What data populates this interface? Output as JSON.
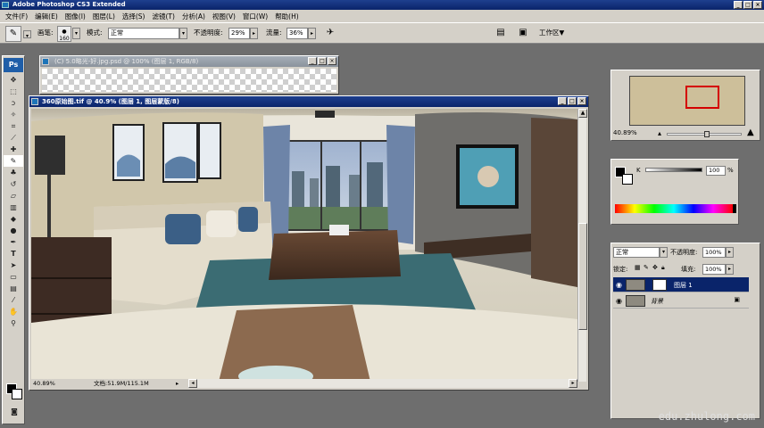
{
  "app": {
    "title": "Adobe Photoshop CS3 Extended",
    "window_buttons": [
      "_",
      "□",
      "×"
    ]
  },
  "menu": [
    "文件(F)",
    "编辑(E)",
    "图像(I)",
    "图层(L)",
    "选择(S)",
    "滤镜(T)",
    "分析(A)",
    "视图(V)",
    "窗口(W)",
    "帮助(H)"
  ],
  "options": {
    "brush_label": "画笔:",
    "brush_size": "160",
    "mode_label": "模式:",
    "mode_value": "正常",
    "opacity_label": "不透明度:",
    "opacity_value": "29%",
    "flow_label": "流量:",
    "flow_value": "36%",
    "workspace_label": "工作区▼"
  },
  "doc_back": {
    "title": "(C) 5.0略光-好.jpg.psd @ 100% (图层 1, RGB/8)"
  },
  "doc_main": {
    "title": "360原始图.tif @ 40.9% (图层 1, 图层蒙版/8)",
    "zoom": "40.89%",
    "file_info": "文档:51.9M/115.1M"
  },
  "navigator": {
    "zoom": "40.89%"
  },
  "color": {
    "channel": "K",
    "value": "100",
    "unit": "%"
  },
  "layers": {
    "blend_mode": "正常",
    "opacity_label": "不透明度:",
    "opacity_value": "100%",
    "lock_label": "锁定:",
    "fill_label": "填充:",
    "fill_value": "100%",
    "items": [
      {
        "name": "图层 1",
        "active": true
      },
      {
        "name": "背景",
        "active": false
      }
    ]
  },
  "watermark": "edu.zhulong.com"
}
